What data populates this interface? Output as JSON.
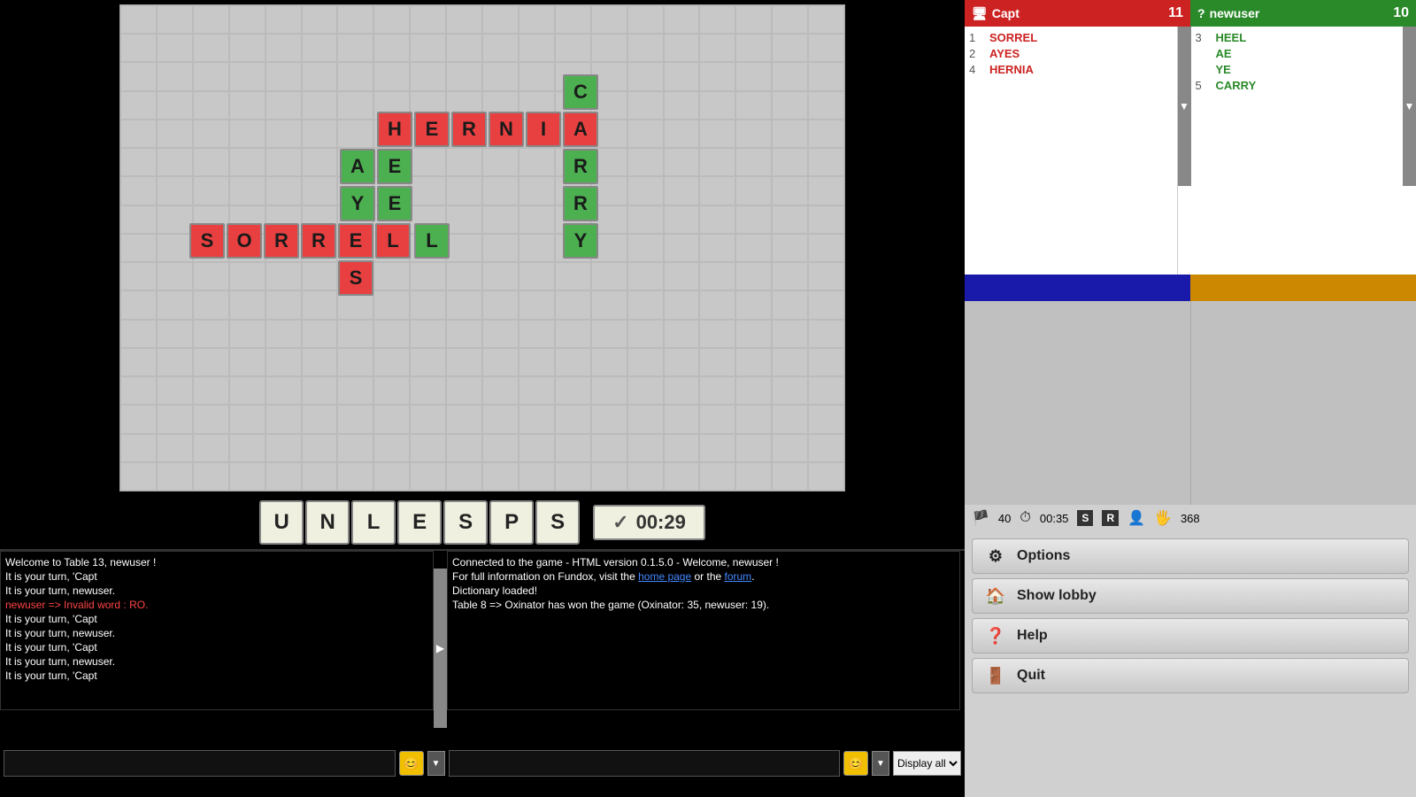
{
  "game": {
    "board": {
      "tiles": [
        {
          "letter": "H",
          "color": "red",
          "row": 3,
          "col": 10
        },
        {
          "letter": "E",
          "color": "red",
          "row": 3,
          "col": 11
        },
        {
          "letter": "R",
          "color": "red",
          "row": 3,
          "col": 12
        },
        {
          "letter": "N",
          "color": "red",
          "row": 3,
          "col": 13
        },
        {
          "letter": "I",
          "color": "red",
          "row": 3,
          "col": 14
        },
        {
          "letter": "A",
          "color": "red",
          "row": 4,
          "col": 15
        },
        {
          "letter": "C",
          "color": "green",
          "row": 1,
          "col": 15
        },
        {
          "letter": "R",
          "color": "green",
          "row": 4,
          "col": 15
        },
        {
          "letter": "R",
          "color": "green",
          "row": 5,
          "col": 15
        },
        {
          "letter": "Y",
          "color": "green",
          "row": 6,
          "col": 15
        },
        {
          "letter": "A",
          "color": "green",
          "row": 4,
          "col": 9
        },
        {
          "letter": "E",
          "color": "green",
          "row": 4,
          "col": 10
        },
        {
          "letter": "Y",
          "color": "green",
          "row": 5,
          "col": 9
        },
        {
          "letter": "E",
          "color": "green",
          "row": 5,
          "col": 10
        },
        {
          "letter": "L",
          "color": "green",
          "row": 6,
          "col": 10
        },
        {
          "letter": "S",
          "color": "red",
          "row": 6,
          "col": 6
        },
        {
          "letter": "O",
          "color": "red",
          "row": 6,
          "col": 7
        },
        {
          "letter": "R",
          "color": "red",
          "row": 6,
          "col": 8
        },
        {
          "letter": "R",
          "color": "red",
          "row": 6,
          "col": 9
        },
        {
          "letter": "E",
          "color": "red",
          "row": 6,
          "col": 10
        },
        {
          "letter": "L",
          "color": "red",
          "row": 6,
          "col": 11
        },
        {
          "letter": "S",
          "color": "red",
          "row": 7,
          "col": 10
        }
      ]
    },
    "rack": [
      "U",
      "N",
      "L",
      "E",
      "S",
      "P",
      "S"
    ],
    "timer": "00:29",
    "rack_label": "UNLESPS"
  },
  "players": {
    "capt": {
      "name": "Capt",
      "score": 11,
      "icon": "🖥",
      "words": [
        {
          "num": 1,
          "word": "SORREL"
        },
        {
          "num": 2,
          "word": "AYES",
          "partial_green": [
            1
          ]
        },
        {
          "num": 4,
          "word": "HERNIA"
        }
      ],
      "rack_color": "#1a1aaa"
    },
    "newuser": {
      "name": "newuser",
      "score": 10,
      "icon": "?",
      "words": [
        {
          "num": 3,
          "word": "HEEL"
        },
        {
          "num": "",
          "word": "AE"
        },
        {
          "num": "",
          "word": "YE"
        },
        {
          "num": 5,
          "word": "CARRY"
        }
      ],
      "rack_color": "#cc8800"
    }
  },
  "status_bar": {
    "flag_icon": "🏴",
    "tiles_count": 40,
    "clock_icon": "⏱",
    "time": "00:35",
    "shuffle_icon": "S",
    "rack_icon": "R",
    "person_icon": "👤",
    "hand_icon": "🖐",
    "score": 368
  },
  "chat_left": [
    {
      "text": "Welcome to Table 13, newuser !",
      "color": "white"
    },
    {
      "text": "It is your turn, 'Capt",
      "color": "white"
    },
    {
      "text": "It is your turn, newuser.",
      "color": "white"
    },
    {
      "text": "newuser => Invalid word : RO.",
      "color": "red"
    },
    {
      "text": "It is your turn, 'Capt",
      "color": "white"
    },
    {
      "text": "It is your turn, newuser.",
      "color": "white"
    },
    {
      "text": "It is your turn, 'Capt",
      "color": "white"
    },
    {
      "text": "It is your turn, newuser.",
      "color": "white"
    },
    {
      "text": "It is your turn, 'Capt",
      "color": "white"
    }
  ],
  "chat_right": [
    {
      "text": "Connected to the game - HTML version 0.1.5.0 - Welcome, newuser !",
      "color": "white"
    },
    {
      "text": "For full information on Fundox, visit the ",
      "color": "white",
      "has_links": true,
      "link1": "home page",
      "link2": "forum"
    },
    {
      "text": "",
      "color": "white"
    },
    {
      "text": "Dictionary loaded!",
      "color": "white"
    },
    {
      "text": "Table 8 => Oxinator has won the game (Oxinator: 35, newuser: 19).",
      "color": "white"
    }
  ],
  "buttons": {
    "options": "Options",
    "show_lobby": "Show lobby",
    "help": "Help",
    "quit": "Quit"
  },
  "inputs": {
    "chat_placeholder": "",
    "chat_right_placeholder": "",
    "display_select": "Display all"
  }
}
